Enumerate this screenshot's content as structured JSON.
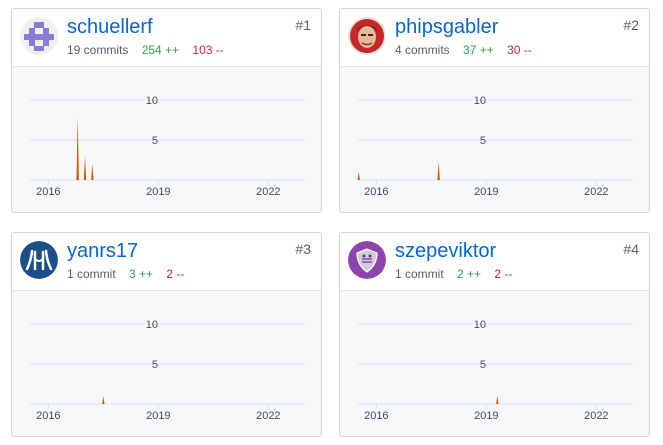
{
  "contributors": [
    {
      "rank": "#1",
      "username": "schuellerf",
      "commits": "19 commits",
      "additions": "254 ++",
      "deletions": "103 --",
      "avatar_icon": "identicon-avatar-icon",
      "chart_data": {
        "type": "bar",
        "y_ticks": [
          "10",
          "5"
        ],
        "x_ticks": [
          "2016",
          "2019",
          "2022"
        ],
        "ylim": [
          0,
          10
        ],
        "xlim": [
          2015.5,
          2023
        ],
        "points": [
          {
            "x": 2016.8,
            "y": 8.0
          },
          {
            "x": 2017.0,
            "y": 3.0
          },
          {
            "x": 2017.2,
            "y": 2.0
          }
        ]
      }
    },
    {
      "rank": "#2",
      "username": "phipsgabler",
      "commits": "4 commits",
      "additions": "37 ++",
      "deletions": "30 --",
      "avatar_icon": "portrait-avatar-icon",
      "chart_data": {
        "type": "bar",
        "y_ticks": [
          "10",
          "5"
        ],
        "x_ticks": [
          "2016",
          "2019",
          "2022"
        ],
        "ylim": [
          0,
          10
        ],
        "xlim": [
          2015.5,
          2023
        ],
        "points": [
          {
            "x": 2015.52,
            "y": 1.0
          },
          {
            "x": 2017.7,
            "y": 2.3
          }
        ]
      }
    },
    {
      "rank": "#3",
      "username": "yanrs17",
      "commits": "1 commit",
      "additions": "3 ++",
      "deletions": "2 --",
      "avatar_icon": "logo-avatar-icon",
      "chart_data": {
        "type": "bar",
        "y_ticks": [
          "10",
          "5"
        ],
        "x_ticks": [
          "2016",
          "2019",
          "2022"
        ],
        "ylim": [
          0,
          10
        ],
        "xlim": [
          2015.5,
          2023
        ],
        "points": [
          {
            "x": 2017.5,
            "y": 1.0
          }
        ]
      }
    },
    {
      "rank": "#4",
      "username": "szepeviktor",
      "commits": "1 commit",
      "additions": "2 ++",
      "deletions": "2 --",
      "avatar_icon": "shield-avatar-icon",
      "chart_data": {
        "type": "bar",
        "y_ticks": [
          "10",
          "5"
        ],
        "x_ticks": [
          "2016",
          "2019",
          "2022"
        ],
        "ylim": [
          0,
          10
        ],
        "xlim": [
          2015.5,
          2023
        ],
        "points": [
          {
            "x": 2019.3,
            "y": 1.0
          }
        ]
      }
    }
  ],
  "colors": {
    "link": "#0366d6",
    "additions": "#28a745",
    "deletions": "#cb2431",
    "bar": "#d15704"
  }
}
